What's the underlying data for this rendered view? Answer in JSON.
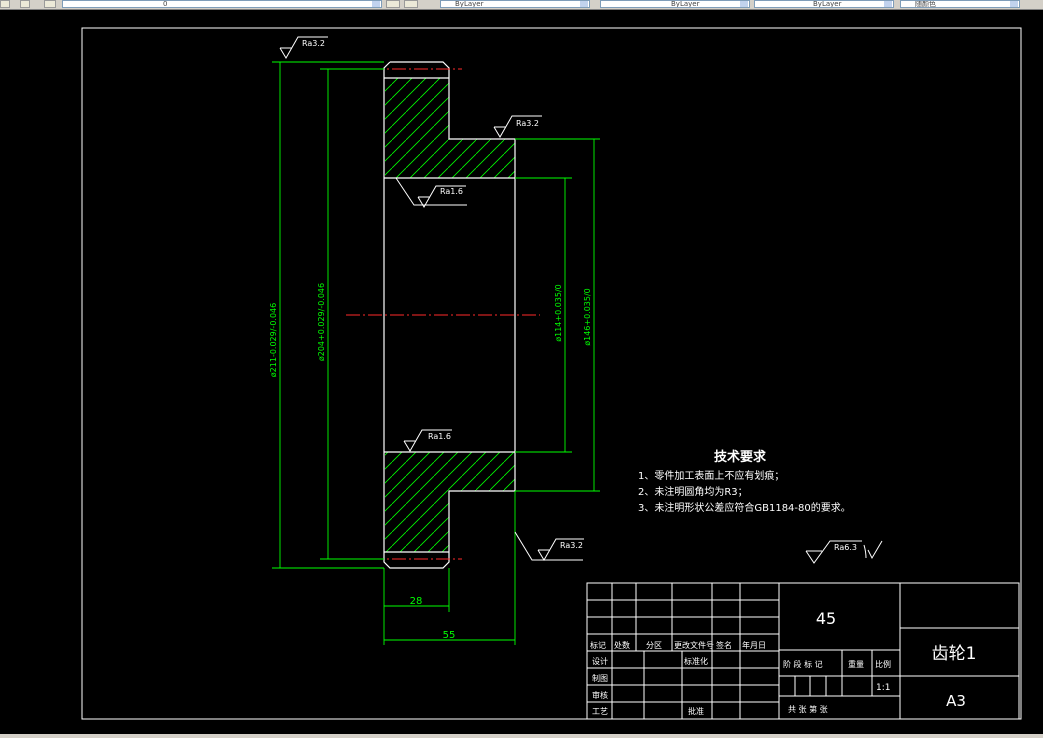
{
  "toolbar": {
    "layer_value": "0",
    "linetype": "ByLayer",
    "lineweight": "ByLayer",
    "plotstyle": "ByLayer",
    "color_combo": "随颜色"
  },
  "drawing": {
    "tech_title": "技术要求",
    "tech_notes": [
      "1、零件加工表面上不应有划痕；",
      "2、未注明圆角均为R3；",
      "3、未注明形状公差应符合GB1184-80的要求。"
    ],
    "dims": {
      "d211": "ø211-0.029/-0.046",
      "d204": "ø204+0.029/-0.046",
      "d114": "ø114+0.035/0",
      "d146": "ø146+0.035/0",
      "w28": "28",
      "w55": "55"
    },
    "roughness": {
      "r1": "Ra3.2",
      "r2": "Ra3.2",
      "r3": "Ra1.6",
      "r4": "Ra1.6",
      "r5": "Ra3.2",
      "r6": "Ra6.3"
    },
    "title_block": {
      "material": "45",
      "part_name": "齿轮1",
      "sheet": "A3",
      "scale_label": "比例",
      "scale": "1:1",
      "weight_label": "重量",
      "stage_label": "阶 段 标 记",
      "sheets_label": "共    张  第    张",
      "rev_headers": [
        "标记",
        "处数",
        "分区",
        "更改文件号",
        "签名",
        "年月日"
      ],
      "roles": [
        "设计",
        "制图",
        "审核",
        "工艺"
      ],
      "std": "标准化",
      "approve": "批准"
    }
  }
}
